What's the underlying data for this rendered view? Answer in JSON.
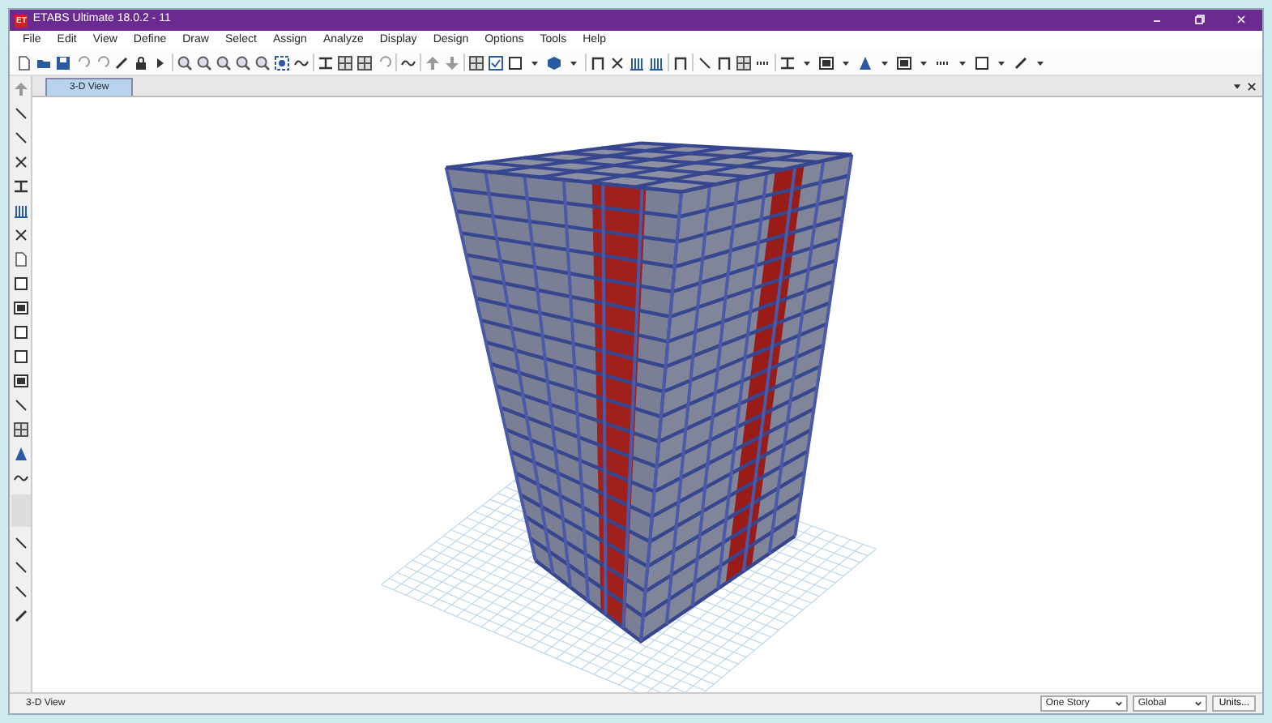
{
  "window": {
    "title": "ETABS Ultimate 18.0.2 - 11",
    "app_badge": "ET"
  },
  "menu": [
    "File",
    "Edit",
    "View",
    "Define",
    "Draw",
    "Select",
    "Assign",
    "Analyze",
    "Display",
    "Design",
    "Options",
    "Tools",
    "Help"
  ],
  "tabs": [
    {
      "label": "3-D View",
      "selected": true
    }
  ],
  "status_bar": {
    "text": "3-D View",
    "story_select": "One Story",
    "coord_select": "Global",
    "units_button": "Units..."
  }
}
